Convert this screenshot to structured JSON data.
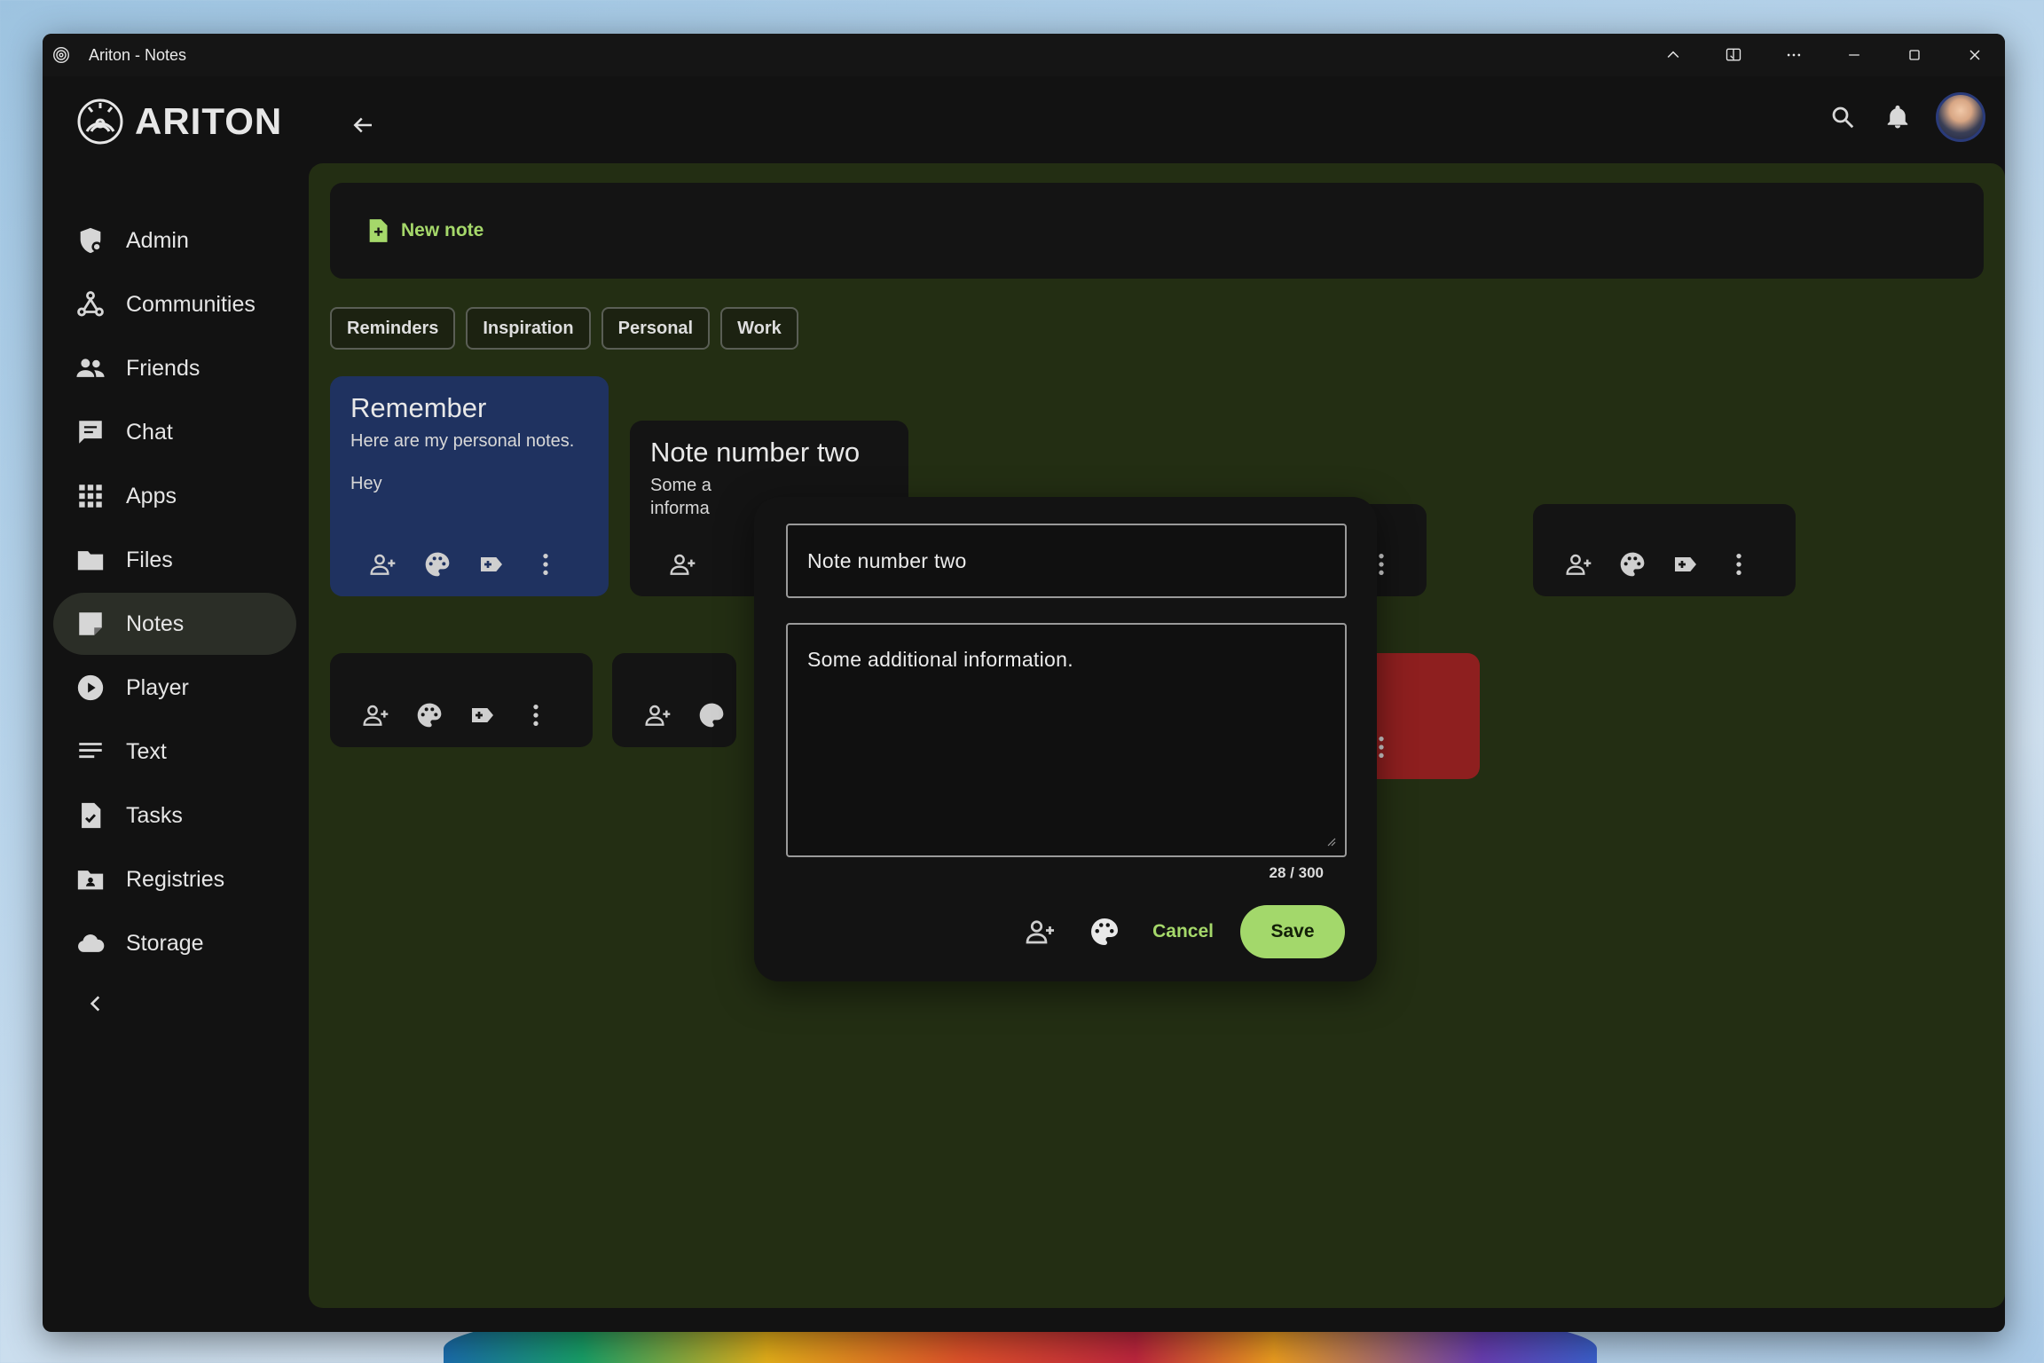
{
  "window": {
    "title": "Ariton - Notes"
  },
  "brand": {
    "name": "ARITON"
  },
  "sidebar": {
    "items": [
      {
        "label": "Admin",
        "icon": "admin-icon"
      },
      {
        "label": "Communities",
        "icon": "communities-icon"
      },
      {
        "label": "Friends",
        "icon": "friends-icon"
      },
      {
        "label": "Chat",
        "icon": "chat-icon"
      },
      {
        "label": "Apps",
        "icon": "apps-icon"
      },
      {
        "label": "Files",
        "icon": "folder-icon"
      },
      {
        "label": "Notes",
        "icon": "notes-icon",
        "active": true
      },
      {
        "label": "Player",
        "icon": "play-icon"
      },
      {
        "label": "Text",
        "icon": "text-icon"
      },
      {
        "label": "Tasks",
        "icon": "tasks-icon"
      },
      {
        "label": "Registries",
        "icon": "registries-icon"
      },
      {
        "label": "Storage",
        "icon": "cloud-icon"
      }
    ]
  },
  "main": {
    "new_note_label": "New note",
    "filters": [
      "Reminders",
      "Inspiration",
      "Personal",
      "Work"
    ],
    "notes": [
      {
        "title": "Remember",
        "body": "Here are my personal notes.",
        "extra": "Hey",
        "color": "#1f3260"
      },
      {
        "title": "Note number two",
        "body": "Some a",
        "body2": "informa",
        "color": "#141414"
      },
      {
        "color": "#8e1f1f"
      }
    ]
  },
  "dialog": {
    "title_value": "Note number two",
    "body_value": "Some additional information.",
    "counter": "28 / 300",
    "cancel_label": "Cancel",
    "save_label": "Save"
  },
  "colors": {
    "accent": "#a5d86a",
    "main_bg": "#232e13",
    "note_blue": "#1f3260",
    "note_red": "#8e1f1f"
  }
}
